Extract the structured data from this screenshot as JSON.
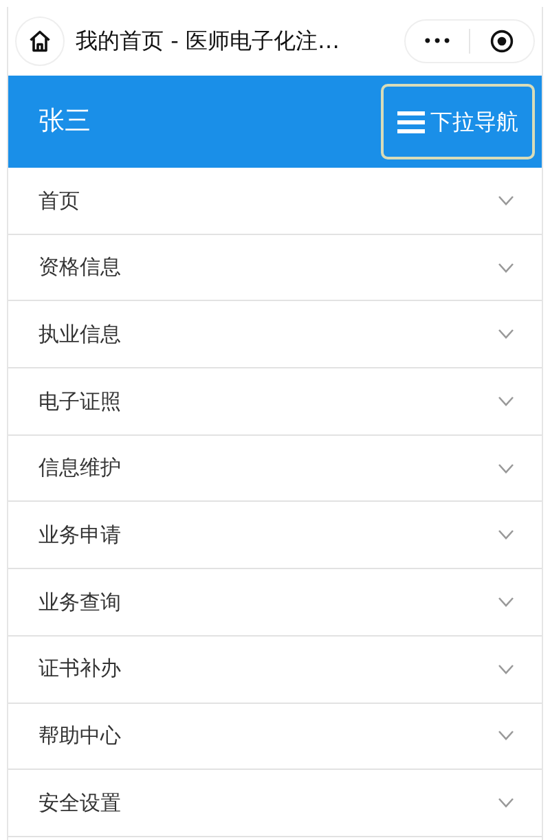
{
  "title_bar": {
    "title": "我的首页 - 医师电子化注…",
    "more": "•••"
  },
  "header": {
    "user": "张三",
    "nav_button": "下拉导航"
  },
  "menu": [
    {
      "label": "首页",
      "expanded": false
    },
    {
      "label": "资格信息",
      "expanded": false
    },
    {
      "label": "执业信息",
      "expanded": false
    },
    {
      "label": "电子证照",
      "expanded": false
    },
    {
      "label": "信息维护",
      "expanded": false
    },
    {
      "label": "业务申请",
      "expanded": false
    },
    {
      "label": "业务查询",
      "expanded": false
    },
    {
      "label": "证书补办",
      "expanded": false
    },
    {
      "label": "帮助中心",
      "expanded": false
    },
    {
      "label": "安全设置",
      "expanded": false
    }
  ]
}
